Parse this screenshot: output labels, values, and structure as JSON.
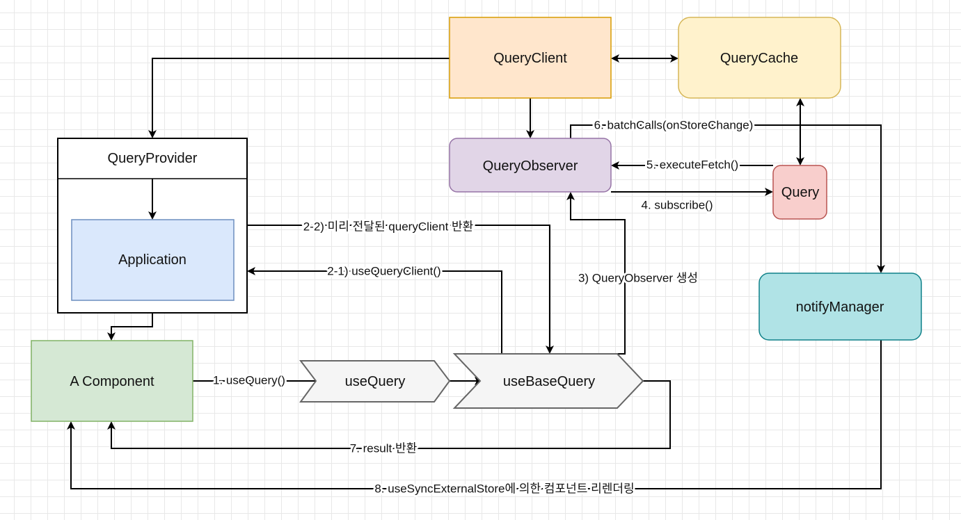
{
  "nodes": {
    "query_client": {
      "label": "QueryClient",
      "fill": "#ffe6cc",
      "stroke": "#d79b00"
    },
    "query_cache": {
      "label": "QueryCache",
      "fill": "#fff2cc",
      "stroke": "#d6b656"
    },
    "query_observer": {
      "label": "QueryObserver",
      "fill": "#e1d5e7",
      "stroke": "#9673a6"
    },
    "query": {
      "label": "Query",
      "fill": "#f8cecc",
      "stroke": "#b85450"
    },
    "notify_manager": {
      "label": "notifyManager",
      "fill": "#b0e3e6",
      "stroke": "#0e8088"
    },
    "query_provider": {
      "label": "QueryProvider",
      "fill": "#ffffff",
      "stroke": "#000000"
    },
    "application": {
      "label": "Application",
      "fill": "#dae8fc",
      "stroke": "#6c8ebf"
    },
    "a_component": {
      "label": "A Component",
      "fill": "#d5e8d4",
      "stroke": "#82b366"
    },
    "use_query": {
      "label": "useQuery",
      "fill": "#f5f5f5",
      "stroke": "#666666"
    },
    "use_base_query": {
      "label": "useBaseQuery",
      "fill": "#f5f5f5",
      "stroke": "#666666"
    }
  },
  "edges": {
    "step1": "1. useQuery()",
    "step2_1": "2-1) useQueryClient()",
    "step2_2": "2-2) 미리 전달된 queryClient 반환",
    "step3": "3) QueryObserver 생성",
    "step4": "4. subscribe()",
    "step5": "5. executeFetch()",
    "step6": "6. batchCalls(onStoreChange)",
    "step7": "7. result 반환",
    "step8": "8. useSyncExternalStore에 의한 컴포넌트 리렌더링"
  }
}
